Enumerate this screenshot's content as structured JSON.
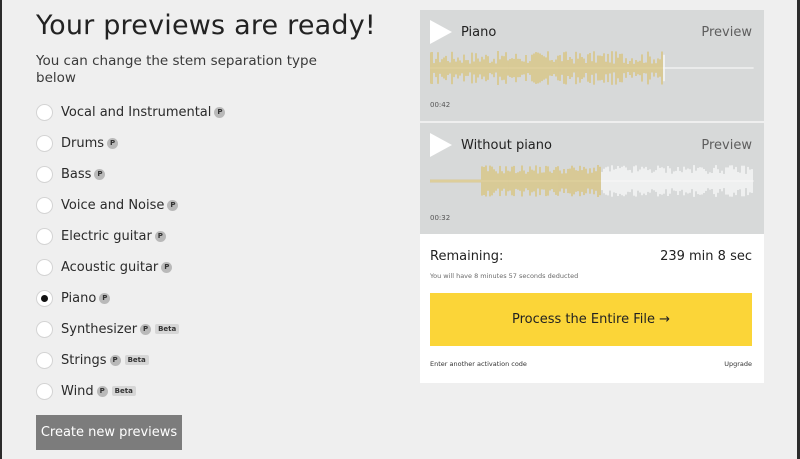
{
  "heading": {
    "title": "Your previews are ready!",
    "subtitle": "You can change the stem separation type below"
  },
  "options": [
    {
      "label": "Vocal and Instrumental",
      "premium": "P",
      "beta": "",
      "checked": false
    },
    {
      "label": "Drums",
      "premium": "P",
      "beta": "",
      "checked": false
    },
    {
      "label": "Bass",
      "premium": "P",
      "beta": "",
      "checked": false
    },
    {
      "label": "Voice and Noise",
      "premium": "P",
      "beta": "",
      "checked": false
    },
    {
      "label": "Electric guitar",
      "premium": "P",
      "beta": "",
      "checked": false
    },
    {
      "label": "Acoustic guitar",
      "premium": "P",
      "beta": "",
      "checked": false
    },
    {
      "label": "Piano",
      "premium": "P",
      "beta": "",
      "checked": true
    },
    {
      "label": "Synthesizer",
      "premium": "P",
      "beta": "Beta",
      "checked": false
    },
    {
      "label": "Strings",
      "premium": "P",
      "beta": "Beta",
      "checked": false
    },
    {
      "label": "Wind",
      "premium": "P",
      "beta": "Beta",
      "checked": false
    }
  ],
  "create_button": "Create new previews",
  "tracks": [
    {
      "name": "Piano",
      "preview": "Preview",
      "time": "00:42",
      "played_fraction": 0.72
    },
    {
      "name": "Without piano",
      "preview": "Preview",
      "time": "00:32",
      "played_fraction": 0.53
    }
  ],
  "remaining": {
    "label": "Remaining:",
    "value": "239 min 8 sec",
    "note": "You will have 8 minutes 57 seconds deducted"
  },
  "process_button": "Process the Entire File →",
  "activation_link": "Enter another activation code",
  "upgrade_link": "Upgrade",
  "colors": {
    "accent_yellow": "#fbd538",
    "wave_played": "#d8bf6a",
    "wave_unplayed": "#ffffff",
    "track_bg": "#d7d9d9",
    "button_gray": "#7c7c7c"
  }
}
